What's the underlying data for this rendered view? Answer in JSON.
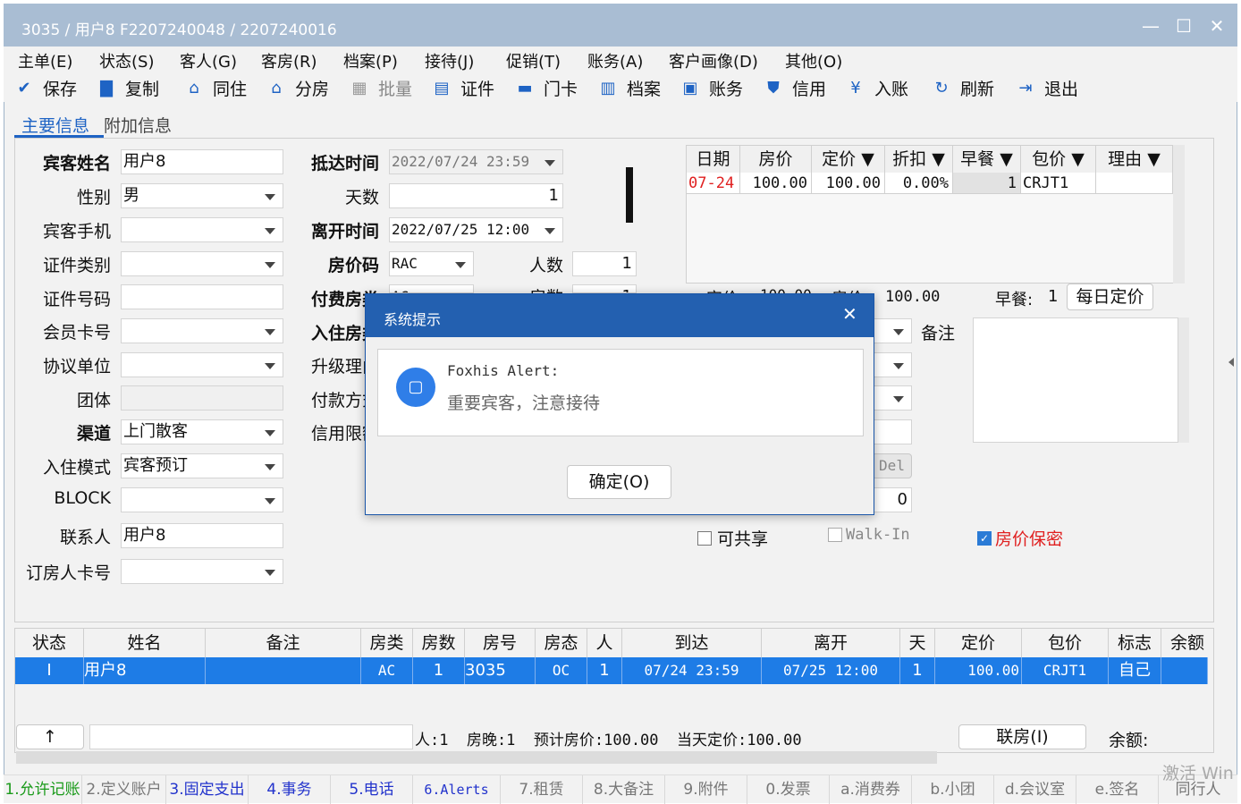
{
  "window": {
    "title": "3035 / 用户8 F2207240048 / 2207240016"
  },
  "menu": [
    "主单(E)",
    "状态(S)",
    "客人(G)",
    "客房(R)",
    "档案(P)",
    "接待(J)",
    "促销(T)",
    "账务(A)",
    "客户画像(D)",
    "其他(O)"
  ],
  "toolbar": [
    {
      "label": "保存",
      "icon": "check-circle-icon"
    },
    {
      "label": "复制",
      "icon": "copy-icon"
    },
    {
      "label": "同住",
      "icon": "home-person-icon"
    },
    {
      "label": "分房",
      "icon": "house-icon"
    },
    {
      "label": "批量",
      "icon": "grid-icon"
    },
    {
      "label": "证件",
      "icon": "id-card-icon"
    },
    {
      "label": "门卡",
      "icon": "card-icon"
    },
    {
      "label": "档案",
      "icon": "folders-icon"
    },
    {
      "label": "账务",
      "icon": "ledger-icon"
    },
    {
      "label": "信用",
      "icon": "shield-icon"
    },
    {
      "label": "入账",
      "icon": "yen-icon"
    },
    {
      "label": "刷新",
      "icon": "refresh-icon"
    },
    {
      "label": "退出",
      "icon": "exit-icon"
    }
  ],
  "tabs": {
    "main": "主要信息",
    "extra": "附加信息"
  },
  "form": {
    "guest_name_label": "宾客姓名",
    "guest_name": "用户8",
    "gender_label": "性别",
    "gender": "男",
    "mobile_label": "宾客手机",
    "mobile": "",
    "id_type_label": "证件类别",
    "id_type": "",
    "id_no_label": "证件号码",
    "id_no": "",
    "member_label": "会员卡号",
    "member": "",
    "agreement_label": "协议单位",
    "agreement": "",
    "group_label": "团体",
    "group": "",
    "channel_label": "渠道",
    "channel": "上门散客",
    "checkin_mode_label": "入住模式",
    "checkin_mode": "宾客预订",
    "block_label": "BLOCK",
    "block": "",
    "contact_label": "联系人",
    "contact": "用户8",
    "booker_label": "订房人卡号",
    "booker": "",
    "arrival_label": "抵达时间",
    "arrival": "2022/07/24 23:59",
    "days_label": "天数",
    "days": "1",
    "departure_label": "离开时间",
    "departure": "2022/07/25 12:00",
    "rate_code_label": "房价码",
    "rate_code": "RAC",
    "persons_label": "人数",
    "persons": "1",
    "paid_room_label": "付费房类",
    "paid_room": "AC",
    "rooms_label": "房数",
    "rooms": "1",
    "checkin_room_label": "入住房类",
    "upgrade_label": "升级理由",
    "payment_label": "付款方式",
    "credit_label": "信用限额",
    "del_button": "Del",
    "zero_value": "0",
    "shareable": "可共享",
    "walkin": "Walk-In",
    "rate_secret": "房价保密",
    "remark_label": "备注",
    "summary_rate_label": "定价",
    "summary_rate": "100.00",
    "summary_price_label": "房价",
    "summary_price": "100.00",
    "breakfast_label": "早餐:",
    "breakfast": "1",
    "daily_rate_button": "每日定价"
  },
  "rate_grid": {
    "headers": [
      "日期",
      "房价",
      "定价 ▼",
      "折扣 ▼",
      "早餐 ▼",
      "包价 ▼",
      "理由 ▼"
    ],
    "row": [
      "07-24",
      "100.00",
      "100.00",
      "0.00%",
      "1",
      "CRJT1",
      ""
    ]
  },
  "dialog": {
    "title": "系统提示",
    "heading": "Foxhis Alert:",
    "message": "重要宾客，注意接待",
    "ok": "确定(O)"
  },
  "guest_grid": {
    "headers": [
      "状态",
      "姓名",
      "备注",
      "房类",
      "房数",
      "房号",
      "房态",
      "人",
      "到达",
      "离开",
      "天",
      "定价",
      "包价",
      "标志",
      "余额"
    ],
    "row": [
      "I",
      "用户8",
      "",
      "AC",
      "1",
      "3035",
      "OC",
      "1",
      "07/24 23:59",
      "07/25 12:00",
      "1",
      "100.00",
      "CRJT1",
      "自己",
      ""
    ]
  },
  "summary_bar": {
    "up_arrow": "↑",
    "text": "人:1  房晚:1  预计房价:100.00  当天定价:100.00",
    "joint_button": "联房(I)",
    "balance_label": "余额:"
  },
  "bottom_tabs": [
    "1.允许记账",
    "2.定义账户",
    "3.固定支出",
    "4.事务",
    "5.电话",
    "6.Alerts",
    "7.租赁",
    "8.大备注",
    "9.附件",
    "0.发票",
    "a.消费券",
    "b.小团",
    "d.会议室",
    "e.签名",
    "同行人"
  ],
  "watermark": "激活 Win",
  "colors": {
    "title_bar": "#a9bdd3",
    "dialog_title": "#2360b0",
    "selected_row": "#1e7ce6",
    "accent_red": "#e02020"
  }
}
